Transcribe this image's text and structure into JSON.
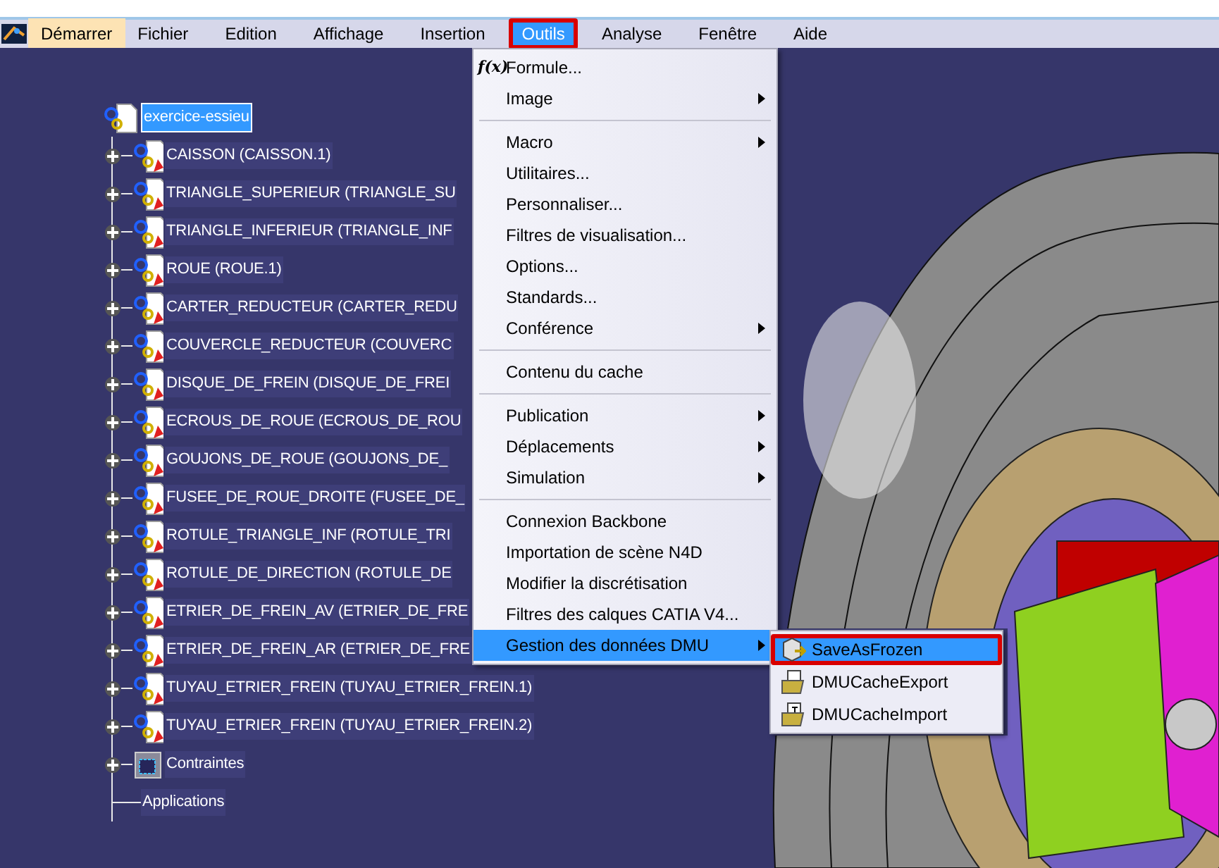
{
  "menu_bar": {
    "items": [
      {
        "label": "Démarrer",
        "kind": "start",
        "selected": false,
        "annotated": false
      },
      {
        "label": "Fichier",
        "kind": "menu",
        "selected": false,
        "annotated": false
      },
      {
        "label": "Edition",
        "kind": "menu",
        "selected": false,
        "annotated": false
      },
      {
        "label": "Affichage",
        "kind": "menu",
        "selected": false,
        "annotated": false
      },
      {
        "label": "Insertion",
        "kind": "menu",
        "selected": false,
        "annotated": false
      },
      {
        "label": "Outils",
        "kind": "menu",
        "selected": true,
        "annotated": true
      },
      {
        "label": "Analyse",
        "kind": "menu",
        "selected": false,
        "annotated": false
      },
      {
        "label": "Fenêtre",
        "kind": "menu",
        "selected": false,
        "annotated": false
      },
      {
        "label": "Aide",
        "kind": "menu",
        "selected": false,
        "annotated": false
      }
    ]
  },
  "tree": {
    "root": {
      "label": "exercice-essieu",
      "selected": true,
      "children": [
        {
          "label": "CAISSON (CAISSON.1)",
          "kind": "product",
          "expandable": true
        },
        {
          "label": "TRIANGLE_SUPERIEUR (TRIANGLE_SU",
          "kind": "product",
          "expandable": true
        },
        {
          "label": "TRIANGLE_INFERIEUR (TRIANGLE_INF",
          "kind": "product",
          "expandable": true
        },
        {
          "label": "ROUE (ROUE.1)",
          "kind": "product",
          "expandable": true
        },
        {
          "label": "CARTER_REDUCTEUR (CARTER_REDU",
          "kind": "product",
          "expandable": true
        },
        {
          "label": "COUVERCLE_REDUCTEUR (COUVERC",
          "kind": "product",
          "expandable": true
        },
        {
          "label": "DISQUE_DE_FREIN (DISQUE_DE_FREI",
          "kind": "product",
          "expandable": true
        },
        {
          "label": "ECROUS_DE_ROUE (ECROUS_DE_ROU",
          "kind": "product",
          "expandable": true
        },
        {
          "label": "GOUJONS_DE_ROUE (GOUJONS_DE_",
          "kind": "product",
          "expandable": true
        },
        {
          "label": "FUSEE_DE_ROUE_DROITE (FUSEE_DE_",
          "kind": "product",
          "expandable": true
        },
        {
          "label": "ROTULE_TRIANGLE_INF (ROTULE_TRI",
          "kind": "product",
          "expandable": true
        },
        {
          "label": "ROTULE_DE_DIRECTION (ROTULE_DE",
          "kind": "product",
          "expandable": true
        },
        {
          "label": "ETRIER_DE_FREIN_AV (ETRIER_DE_FRE",
          "kind": "product",
          "expandable": true
        },
        {
          "label": "ETRIER_DE_FREIN_AR (ETRIER_DE_FRE",
          "kind": "product",
          "expandable": true
        },
        {
          "label": "TUYAU_ETRIER_FREIN (TUYAU_ETRIER_FREIN.1)",
          "kind": "product",
          "expandable": true
        },
        {
          "label": "TUYAU_ETRIER_FREIN (TUYAU_ETRIER_FREIN.2)",
          "kind": "product",
          "expandable": true
        },
        {
          "label": "Contraintes",
          "kind": "constraints",
          "expandable": true
        },
        {
          "label": "Applications",
          "kind": "plain",
          "expandable": false
        }
      ]
    }
  },
  "tools_menu": {
    "groups": [
      [
        {
          "label": "Formule...",
          "icon": "f(x)",
          "submenu": false,
          "selected": false
        },
        {
          "label": "Image",
          "submenu": true,
          "selected": false
        }
      ],
      [
        {
          "label": "Macro",
          "submenu": true,
          "selected": false
        },
        {
          "label": "Utilitaires...",
          "submenu": false,
          "selected": false
        },
        {
          "label": "Personnaliser...",
          "submenu": false,
          "selected": false
        },
        {
          "label": "Filtres de visualisation...",
          "submenu": false,
          "selected": false
        },
        {
          "label": "Options...",
          "submenu": false,
          "selected": false
        },
        {
          "label": "Standards...",
          "submenu": false,
          "selected": false
        },
        {
          "label": "Conférence",
          "submenu": true,
          "selected": false
        }
      ],
      [
        {
          "label": "Contenu du cache",
          "submenu": false,
          "selected": false
        }
      ],
      [
        {
          "label": "Publication",
          "submenu": true,
          "selected": false
        },
        {
          "label": "Déplacements",
          "submenu": true,
          "selected": false
        },
        {
          "label": "Simulation",
          "submenu": true,
          "selected": false
        }
      ],
      [
        {
          "label": "Connexion Backbone",
          "submenu": false,
          "selected": false
        },
        {
          "label": "Importation de scène N4D",
          "submenu": false,
          "selected": false
        },
        {
          "label": "Modifier la discrétisation",
          "submenu": false,
          "selected": false
        },
        {
          "label": "Filtres des calques CATIA V4...",
          "submenu": false,
          "selected": false
        },
        {
          "label": "Gestion des données DMU",
          "submenu": true,
          "selected": true
        }
      ]
    ]
  },
  "dmu_submenu": {
    "items": [
      {
        "label": "SaveAsFrozen",
        "kind": "save",
        "selected": true,
        "annotated": true
      },
      {
        "label": "DMUCacheExport",
        "kind": "export",
        "selected": false,
        "annotated": false
      },
      {
        "label": "DMUCacheImport",
        "kind": "import",
        "selected": false,
        "annotated": false
      }
    ]
  }
}
